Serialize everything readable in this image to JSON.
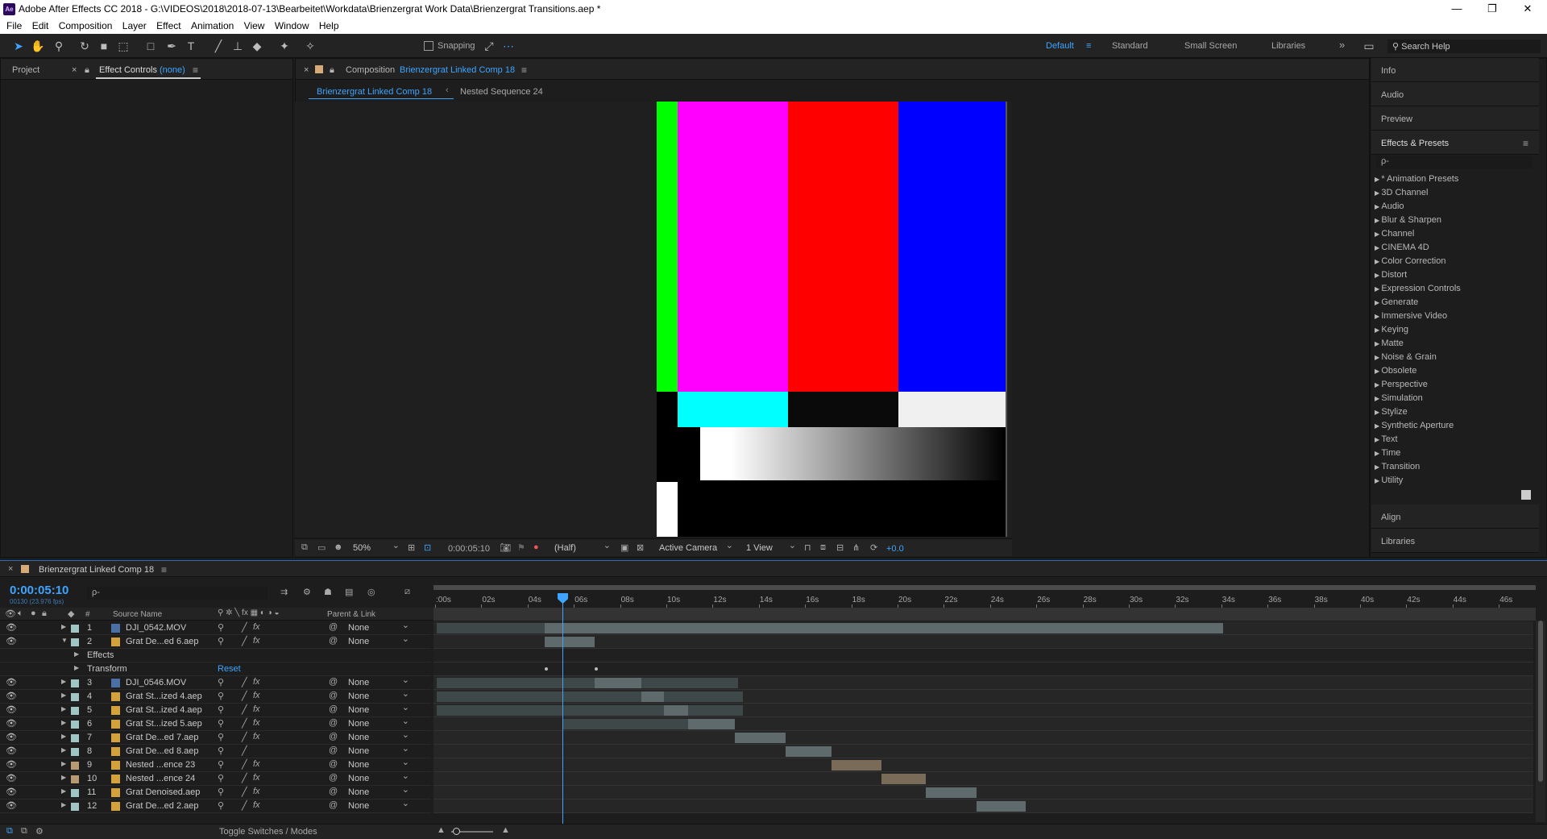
{
  "window": {
    "title": "Adobe After Effects CC 2018 - G:\\VIDEOS\\2018\\2018-07-13\\Bearbeitet\\Workdata\\Brienzergrat Work Data\\Brienzergrat Transitions.aep *",
    "app_icon": "Ae"
  },
  "menu": [
    "File",
    "Edit",
    "Composition",
    "Layer",
    "Effect",
    "Animation",
    "View",
    "Window",
    "Help"
  ],
  "toolbar": {
    "snapping_label": "Snapping",
    "workspaces": [
      "Default",
      "Standard",
      "Small Screen",
      "Libraries"
    ],
    "search_placeholder": "Search Help"
  },
  "left_panel": {
    "project_tab": "Project",
    "effect_controls_tab": "Effect Controls",
    "effect_controls_target": "(none)"
  },
  "comp_panel": {
    "tab_label": "Composition",
    "comp_name": "Brienzergrat Linked Comp 18",
    "breadcrumbs": [
      "Brienzergrat Linked Comp 18",
      "Nested Sequence 24"
    ],
    "zoom": "50%",
    "timecode": "0:00:05:10",
    "resolution": "(Half)",
    "camera": "Active Camera",
    "views": "1 View",
    "exposure": "+0.0"
  },
  "right_panel": {
    "headers": [
      "Info",
      "Audio",
      "Preview"
    ],
    "effects_title": "Effects & Presets",
    "search_placeholder": "ρ-",
    "categories": [
      "* Animation Presets",
      "3D Channel",
      "Audio",
      "Blur & Sharpen",
      "Channel",
      "CINEMA 4D",
      "Color Correction",
      "Distort",
      "Expression Controls",
      "Generate",
      "Immersive Video",
      "Keying",
      "Matte",
      "Noise & Grain",
      "Obsolete",
      "Perspective",
      "Simulation",
      "Stylize",
      "Synthetic Aperture",
      "Text",
      "Time",
      "Transition",
      "Utility"
    ],
    "footers": [
      "Align",
      "Libraries"
    ]
  },
  "timeline": {
    "comp_name": "Brienzergrat Linked Comp 18",
    "timecode": "0:00:05:10",
    "frame_info": "00130 (23.976 fps)",
    "search_placeholder": "ρ-",
    "col_num": "#",
    "col_source": "Source Name",
    "col_parent": "Parent & Link",
    "ruler": [
      ":00s",
      "02s",
      "04s",
      "06s",
      "08s",
      "10s",
      "12s",
      "14s",
      "16s",
      "18s",
      "20s",
      "22s",
      "24s",
      "26s",
      "28s",
      "30s",
      "32s",
      "34s",
      "36s",
      "38s",
      "40s",
      "42s",
      "44s",
      "46s"
    ],
    "sub_effects": "Effects",
    "sub_transform": "Transform",
    "reset": "Reset",
    "toggle_label": "Toggle Switches / Modes",
    "layers": [
      {
        "num": "1",
        "name": "DJI_0542.MOV",
        "parent": "None",
        "fx": true
      },
      {
        "num": "2",
        "name": "Grat De...ed 6.aep",
        "parent": "None",
        "fx": true
      },
      {
        "num": "3",
        "name": "DJI_0546.MOV",
        "parent": "None",
        "fx": true
      },
      {
        "num": "4",
        "name": "Grat St...ized 4.aep",
        "parent": "None",
        "fx": true
      },
      {
        "num": "5",
        "name": "Grat St...ized 4.aep",
        "parent": "None",
        "fx": true
      },
      {
        "num": "6",
        "name": "Grat St...ized 5.aep",
        "parent": "None",
        "fx": true
      },
      {
        "num": "7",
        "name": "Grat De...ed 7.aep",
        "parent": "None",
        "fx": true
      },
      {
        "num": "8",
        "name": "Grat De...ed 8.aep",
        "parent": "None",
        "fx": false
      },
      {
        "num": "9",
        "name": "Nested ...ence 23",
        "parent": "None",
        "fx": true
      },
      {
        "num": "10",
        "name": "Nested ...ence 24",
        "parent": "None",
        "fx": true
      },
      {
        "num": "11",
        "name": "Grat Denoised.aep",
        "parent": "None",
        "fx": true
      },
      {
        "num": "12",
        "name": "Grat De...ed 2.aep",
        "parent": "None",
        "fx": true
      }
    ]
  },
  "colors": {
    "accent": "#3da5ff",
    "clip": "#5e6a6b",
    "clip_orange": "#7a6a58",
    "label": "#9fc6c4"
  }
}
